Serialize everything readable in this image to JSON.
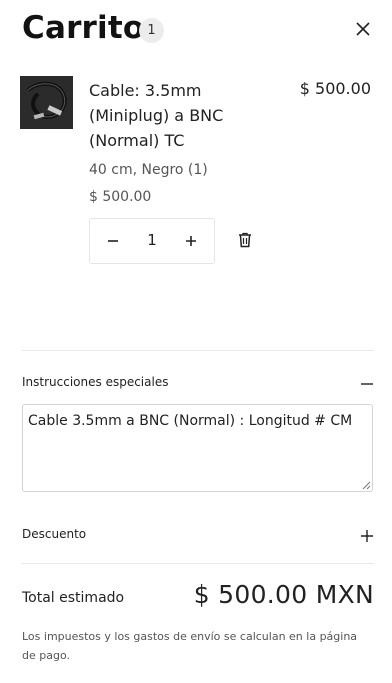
{
  "header": {
    "title": "Carrito",
    "count": "1",
    "close_icon": "close-icon"
  },
  "item": {
    "name": "Cable: 3.5mm (Miniplug) a BNC (Normal) TC",
    "line_total": "$ 500.00",
    "variant": "40 cm, Negro (1)",
    "unit_price": "$ 500.00",
    "quantity": "1",
    "image_icon": "cable-product-image"
  },
  "instructions": {
    "label": "Instrucciones especiales",
    "value": "Cable 3.5mm a BNC (Normal) : Longitud # CM",
    "toggle_icon": "minus-icon"
  },
  "discount": {
    "label": "Descuento",
    "toggle_icon": "plus-icon"
  },
  "summary": {
    "total_label": "Total estimado",
    "total_value": "$ 500.00 MXN",
    "tax_note": "Los impuestos y los gastos de envío se calculan en la página de pago."
  }
}
